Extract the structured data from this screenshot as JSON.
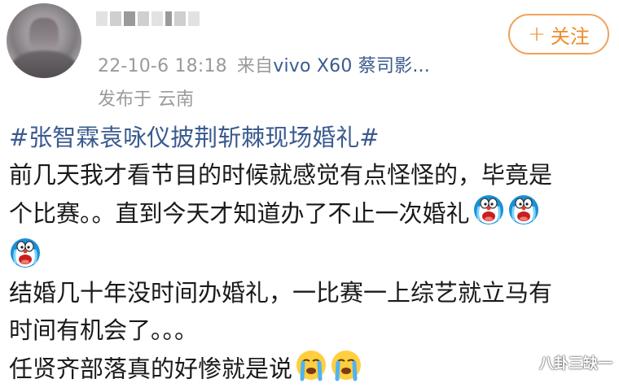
{
  "post": {
    "timestamp": "22-10-6 18:18",
    "source_prefix": "来自",
    "source_device": "vivo X60 蔡司影...",
    "location_label": "发布于",
    "location_value": "云南",
    "follow_label": "关注",
    "hashtag": "#张智霖袁咏仪披荆斩棘现场婚礼#",
    "line1": "前几天我才看节目的时候就感觉有点怪怪的，毕竟是",
    "line2": "个比赛。。直到今天才知道办了不止一次婚礼",
    "line3": "结婚几十年没时间办婚礼，一比赛一上综艺就立马有",
    "line4": "时间有机会了。。。",
    "line5": "任贤齐部落真的好惨就是说"
  },
  "emojis": {
    "doraemon": "doraemon-crying-icon",
    "crying": "crying-face-icon"
  },
  "watermark": "八卦三缺一",
  "colors": {
    "link": "#3b5b8f",
    "meta": "#9a9a9a",
    "follow": "#f08a2a",
    "follow_border": "#f1a15b",
    "text": "#1a1a1a"
  }
}
